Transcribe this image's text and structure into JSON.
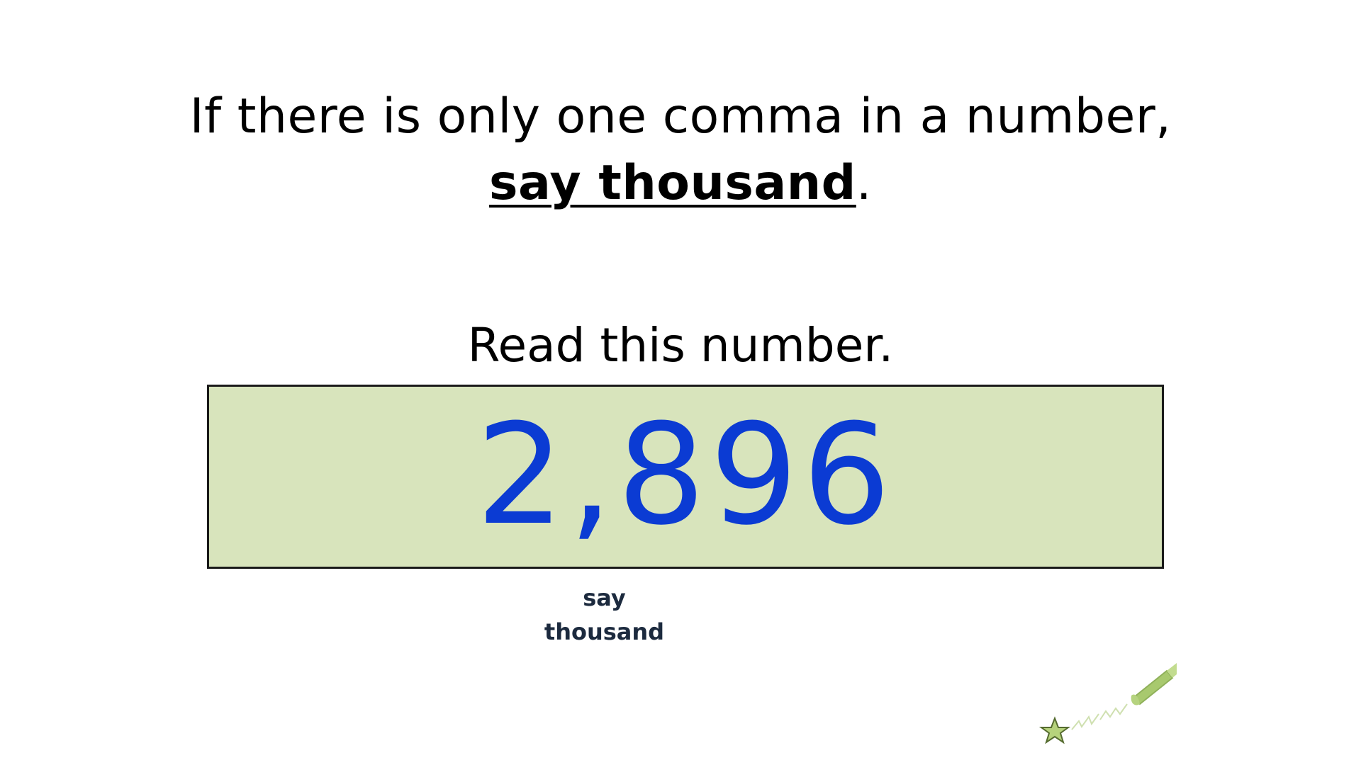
{
  "rule": {
    "line1": "If there is only one comma in a number,",
    "emphasis": "say thousand",
    "line2_suffix": "."
  },
  "prompt": "Read this number.",
  "number": {
    "value": "2,896",
    "color": "#0b3bd3",
    "box_color": "#d8e4bc"
  },
  "annotation": {
    "line1": "say",
    "line2": "thousand"
  },
  "decoration": {
    "icon": "star-and-wand-icon",
    "color": "#9bbb59"
  }
}
